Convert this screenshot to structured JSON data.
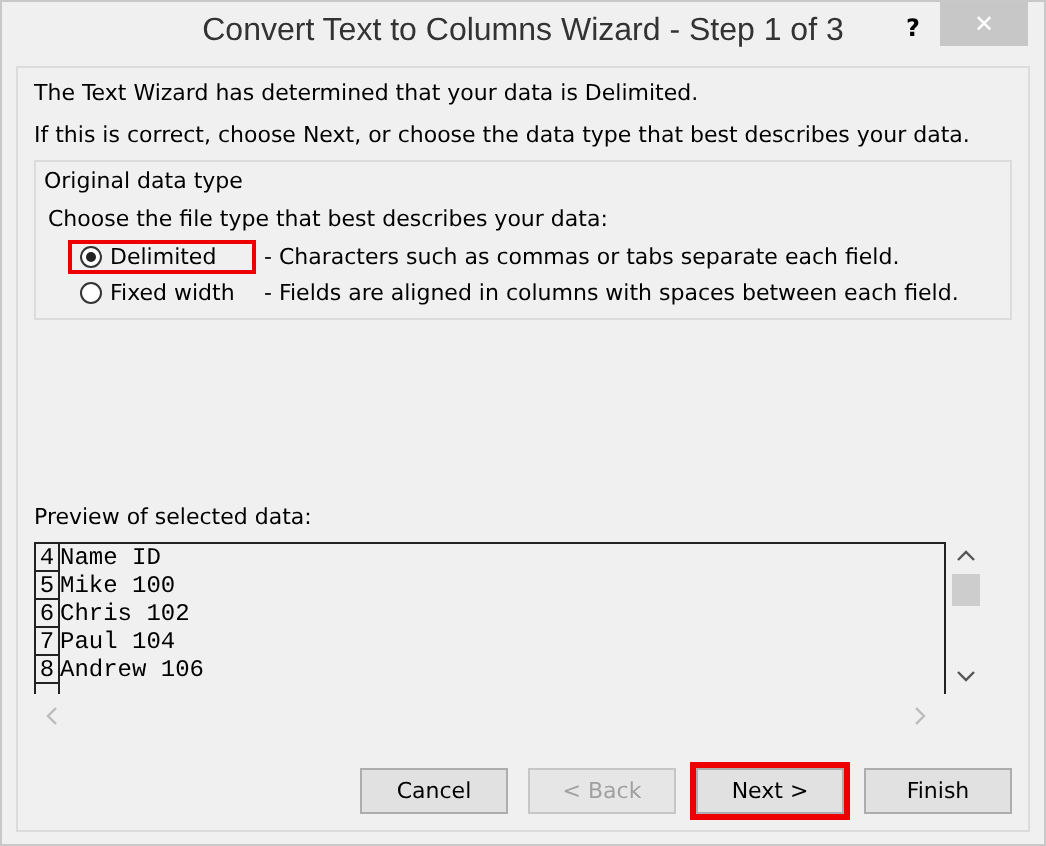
{
  "window": {
    "title": "Convert Text to Columns Wizard - Step 1 of 3",
    "help": "?",
    "close": "✕"
  },
  "intro": [
    "The Text Wizard has determined that your data is Delimited.",
    "If this is correct, choose Next, or choose the data type that best describes your data."
  ],
  "group": {
    "legend": "Original data type",
    "prompt": "Choose the file type that best describes your data:",
    "options": [
      {
        "label": "Delimited",
        "description": "- Characters such as commas or tabs separate each field.",
        "selected": true,
        "highlighted": true
      },
      {
        "label": "Fixed width",
        "description": "- Fields are aligned in columns with spaces between each field.",
        "selected": false,
        "highlighted": false
      }
    ]
  },
  "preview": {
    "label": "Preview of selected data:",
    "rows": [
      {
        "number": "4",
        "text": "Name ID"
      },
      {
        "number": "5",
        "text": "Mike 100"
      },
      {
        "number": "6",
        "text": "Chris 102"
      },
      {
        "number": "7",
        "text": "Paul 104"
      },
      {
        "number": "8",
        "text": "Andrew 106"
      }
    ]
  },
  "buttons": [
    {
      "label": "Cancel",
      "disabled": false,
      "highlighted": false
    },
    {
      "label": "< Back",
      "disabled": true,
      "highlighted": false
    },
    {
      "label": "Next >",
      "disabled": false,
      "highlighted": true
    },
    {
      "label": "Finish",
      "disabled": false,
      "highlighted": false
    }
  ]
}
